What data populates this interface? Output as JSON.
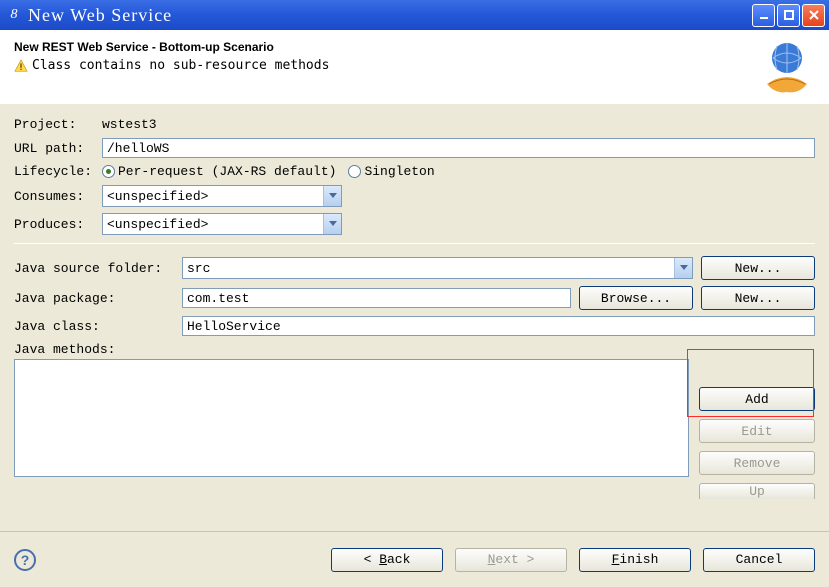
{
  "window": {
    "title": "New Web Service"
  },
  "header": {
    "title": "New REST Web Service - Bottom-up Scenario",
    "warning": "Class contains no sub-resource methods"
  },
  "form": {
    "labels": {
      "project": "Project:",
      "url_path": "URL path:",
      "lifecycle": "Lifecycle:",
      "consumes": "Consumes:",
      "produces": "Produces:",
      "source_folder": "Java source folder:",
      "package": "Java package:",
      "class": "Java class:",
      "methods": "Java methods:"
    },
    "project_value": "wstest3",
    "url_path_value": "/helloWS",
    "lifecycle_options": {
      "per_request": "Per-request (JAX-RS default)",
      "singleton": "Singleton"
    },
    "unspecified": "<unspecified>",
    "source_folder_value": "src",
    "package_value": "com.test",
    "class_value": "HelloService"
  },
  "buttons": {
    "new": "New...",
    "browse": "Browse...",
    "add": "Add",
    "edit": "Edit",
    "remove": "Remove",
    "up": "Up",
    "back": "< Back",
    "next": "Next >",
    "finish": "Finish",
    "cancel": "Cancel"
  }
}
